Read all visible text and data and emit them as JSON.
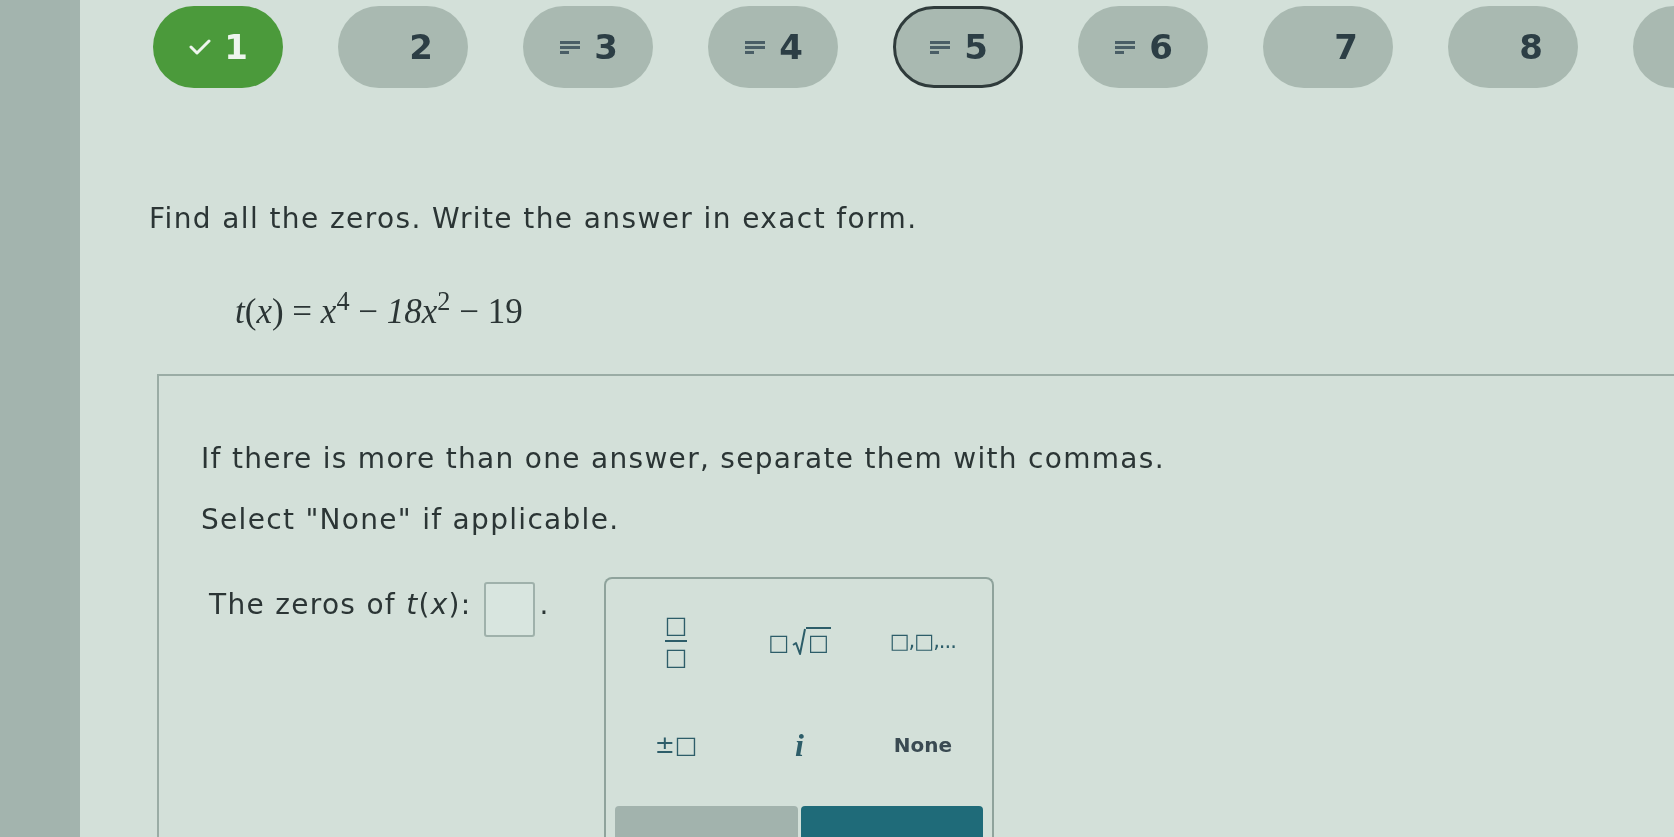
{
  "question_nav": {
    "items": [
      {
        "label": "1",
        "kind": "correct",
        "selected": false
      },
      {
        "label": "2",
        "kind": "unanswered",
        "selected": false
      },
      {
        "label": "3",
        "kind": "attempted",
        "selected": false
      },
      {
        "label": "4",
        "kind": "attempted",
        "selected": false
      },
      {
        "label": "5",
        "kind": "attempted",
        "selected": true
      },
      {
        "label": "6",
        "kind": "attempted",
        "selected": false
      },
      {
        "label": "7",
        "kind": "unanswered",
        "selected": false
      },
      {
        "label": "8",
        "kind": "unanswered",
        "selected": false
      }
    ],
    "partial_item_at_edge": true
  },
  "question": {
    "instruction": "Find all the zeros. Write the answer in exact form.",
    "function": "*t*(*x*) = *x*$^{4}$ − *18x*$^{2}$ − 19"
  },
  "answer_panel": {
    "hints": [
      "If there is more than one answer, separate them with commas.",
      "Select \"None\" if applicable."
    ],
    "prompt": "The zeros of *t*(*x*):",
    "after_field": "."
  },
  "keypad": {
    "keys": [
      {
        "kind": "fraction",
        "numerator": "□",
        "denominator": "□"
      },
      {
        "kind": "root",
        "index": "□",
        "radicand": "□"
      },
      {
        "kind": "list",
        "label": "□,□,..."
      },
      {
        "kind": "plus_minus",
        "label": "±□"
      },
      {
        "kind": "imaginary",
        "label": "i"
      },
      {
        "kind": "none",
        "label": "None"
      }
    ],
    "action_buttons": [
      {
        "kind": "secondary"
      },
      {
        "kind": "primary"
      }
    ]
  }
}
